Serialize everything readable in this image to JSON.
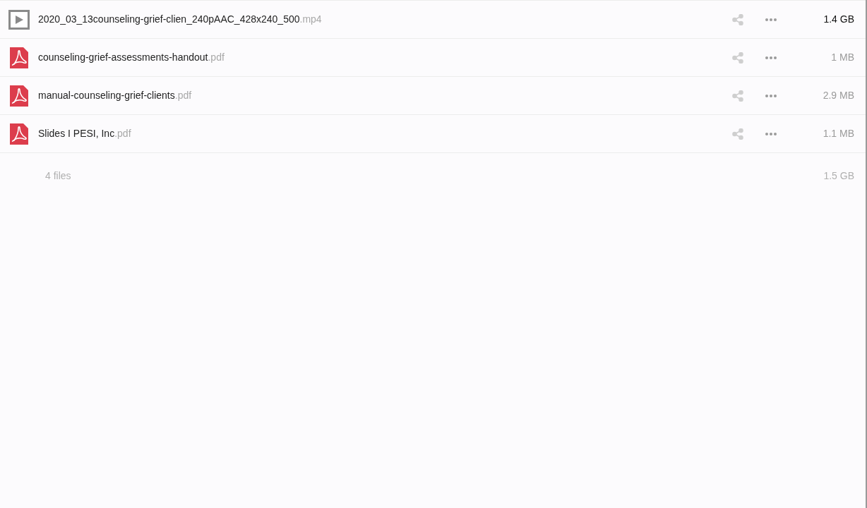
{
  "files": [
    {
      "kind": "video",
      "name": "2020_03_13counseling-grief-clien_240pAAC_428x240_500",
      "extension": ".mp4",
      "size": "1.4 GB",
      "size_emphasized": true
    },
    {
      "kind": "pdf",
      "name": "counseling-grief-assessments-handout",
      "extension": ".pdf",
      "size": "1 MB",
      "size_emphasized": false
    },
    {
      "kind": "pdf",
      "name": "manual-counseling-grief-clients",
      "extension": ".pdf",
      "size": "2.9 MB",
      "size_emphasized": false
    },
    {
      "kind": "pdf",
      "name": "Slides I PESI, Inc",
      "extension": ".pdf",
      "size": "1.1 MB",
      "size_emphasized": false
    }
  ],
  "summary": {
    "count": "4 files",
    "total": "1.5 GB"
  }
}
